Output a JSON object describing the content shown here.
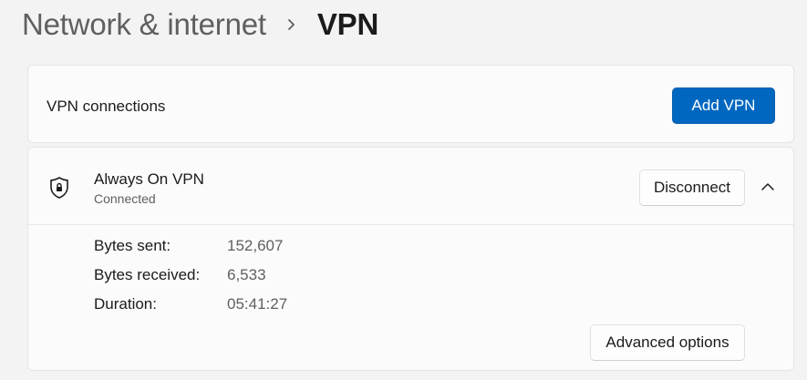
{
  "breadcrumb": {
    "parent": "Network & internet",
    "current": "VPN"
  },
  "connections_card": {
    "label": "VPN connections",
    "add_button": "Add VPN"
  },
  "vpn": {
    "name": "Always On VPN",
    "status": "Connected",
    "disconnect_button": "Disconnect",
    "details": [
      {
        "key": "Bytes sent:",
        "value": "152,607"
      },
      {
        "key": "Bytes received:",
        "value": "6,533"
      },
      {
        "key": "Duration:",
        "value": "05:41:27"
      }
    ],
    "advanced_button": "Advanced options"
  },
  "colors": {
    "accent": "#0067c0",
    "background": "#f3f3f3",
    "card": "#fbfbfb"
  },
  "icons": {
    "breadcrumb_separator": "chevron-right-icon",
    "vpn_icon": "shield-lock-icon",
    "expand_toggle": "chevron-up-icon"
  }
}
